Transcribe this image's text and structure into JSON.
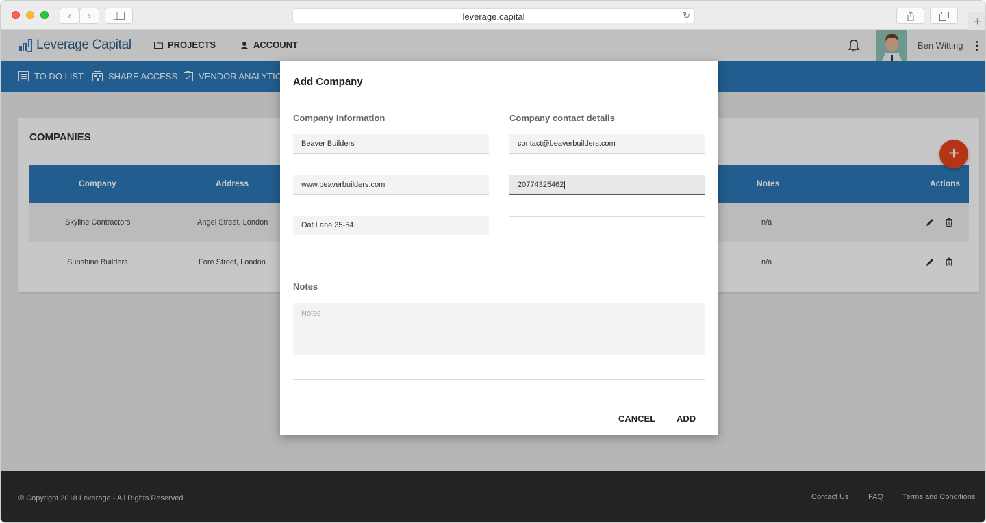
{
  "browser": {
    "url": "leverage.capital",
    "back_icon": "chevron-left-icon",
    "forward_icon": "chevron-right-icon"
  },
  "header": {
    "logo_text": "Leverage Capital",
    "nav": [
      {
        "label": "PROJECTS",
        "icon": "folder-icon"
      },
      {
        "label": "ACCOUNT",
        "icon": "user-icon"
      }
    ],
    "user_name": "Ben Witting"
  },
  "subnav": {
    "items": [
      {
        "label": "TO DO LIST",
        "icon": "list-icon"
      },
      {
        "label": "SHARE ACCESS",
        "icon": "building-icon"
      },
      {
        "label": "VENDOR ANALYTICS",
        "icon": "clipboard-icon"
      }
    ]
  },
  "companies": {
    "title": "COMPANIES",
    "columns": [
      "Company",
      "Address",
      "Notes",
      "Actions"
    ],
    "rows": [
      {
        "company": "Skyline Contractors",
        "address": "Angel Street, London",
        "notes": "n/a"
      },
      {
        "company": "Sunshine Builders",
        "address": "Fore Street, London",
        "notes": "n/a"
      }
    ],
    "add_label": "+"
  },
  "modal": {
    "title": "Add Company",
    "info_label": "Company Information",
    "contact_label": "Company contact details",
    "company_name": "Beaver Builders",
    "website": "www.beaverbuilders.com",
    "address": "Oat Lane 35-54",
    "email": "contact@beaverbuilders.com",
    "phone": "20774325462",
    "notes_label": "Notes",
    "notes_placeholder": "Notes",
    "cancel_label": "CANCEL",
    "add_label": "ADD"
  },
  "footer": {
    "copyright": "© Copyright 2018 Leverage - All Rights Reserved",
    "links": [
      "Contact Us",
      "FAQ",
      "Terms and Conditions"
    ]
  },
  "colors": {
    "primary": "#2b78b7",
    "fab": "#e8431c",
    "footer": "#2d2d2d"
  }
}
